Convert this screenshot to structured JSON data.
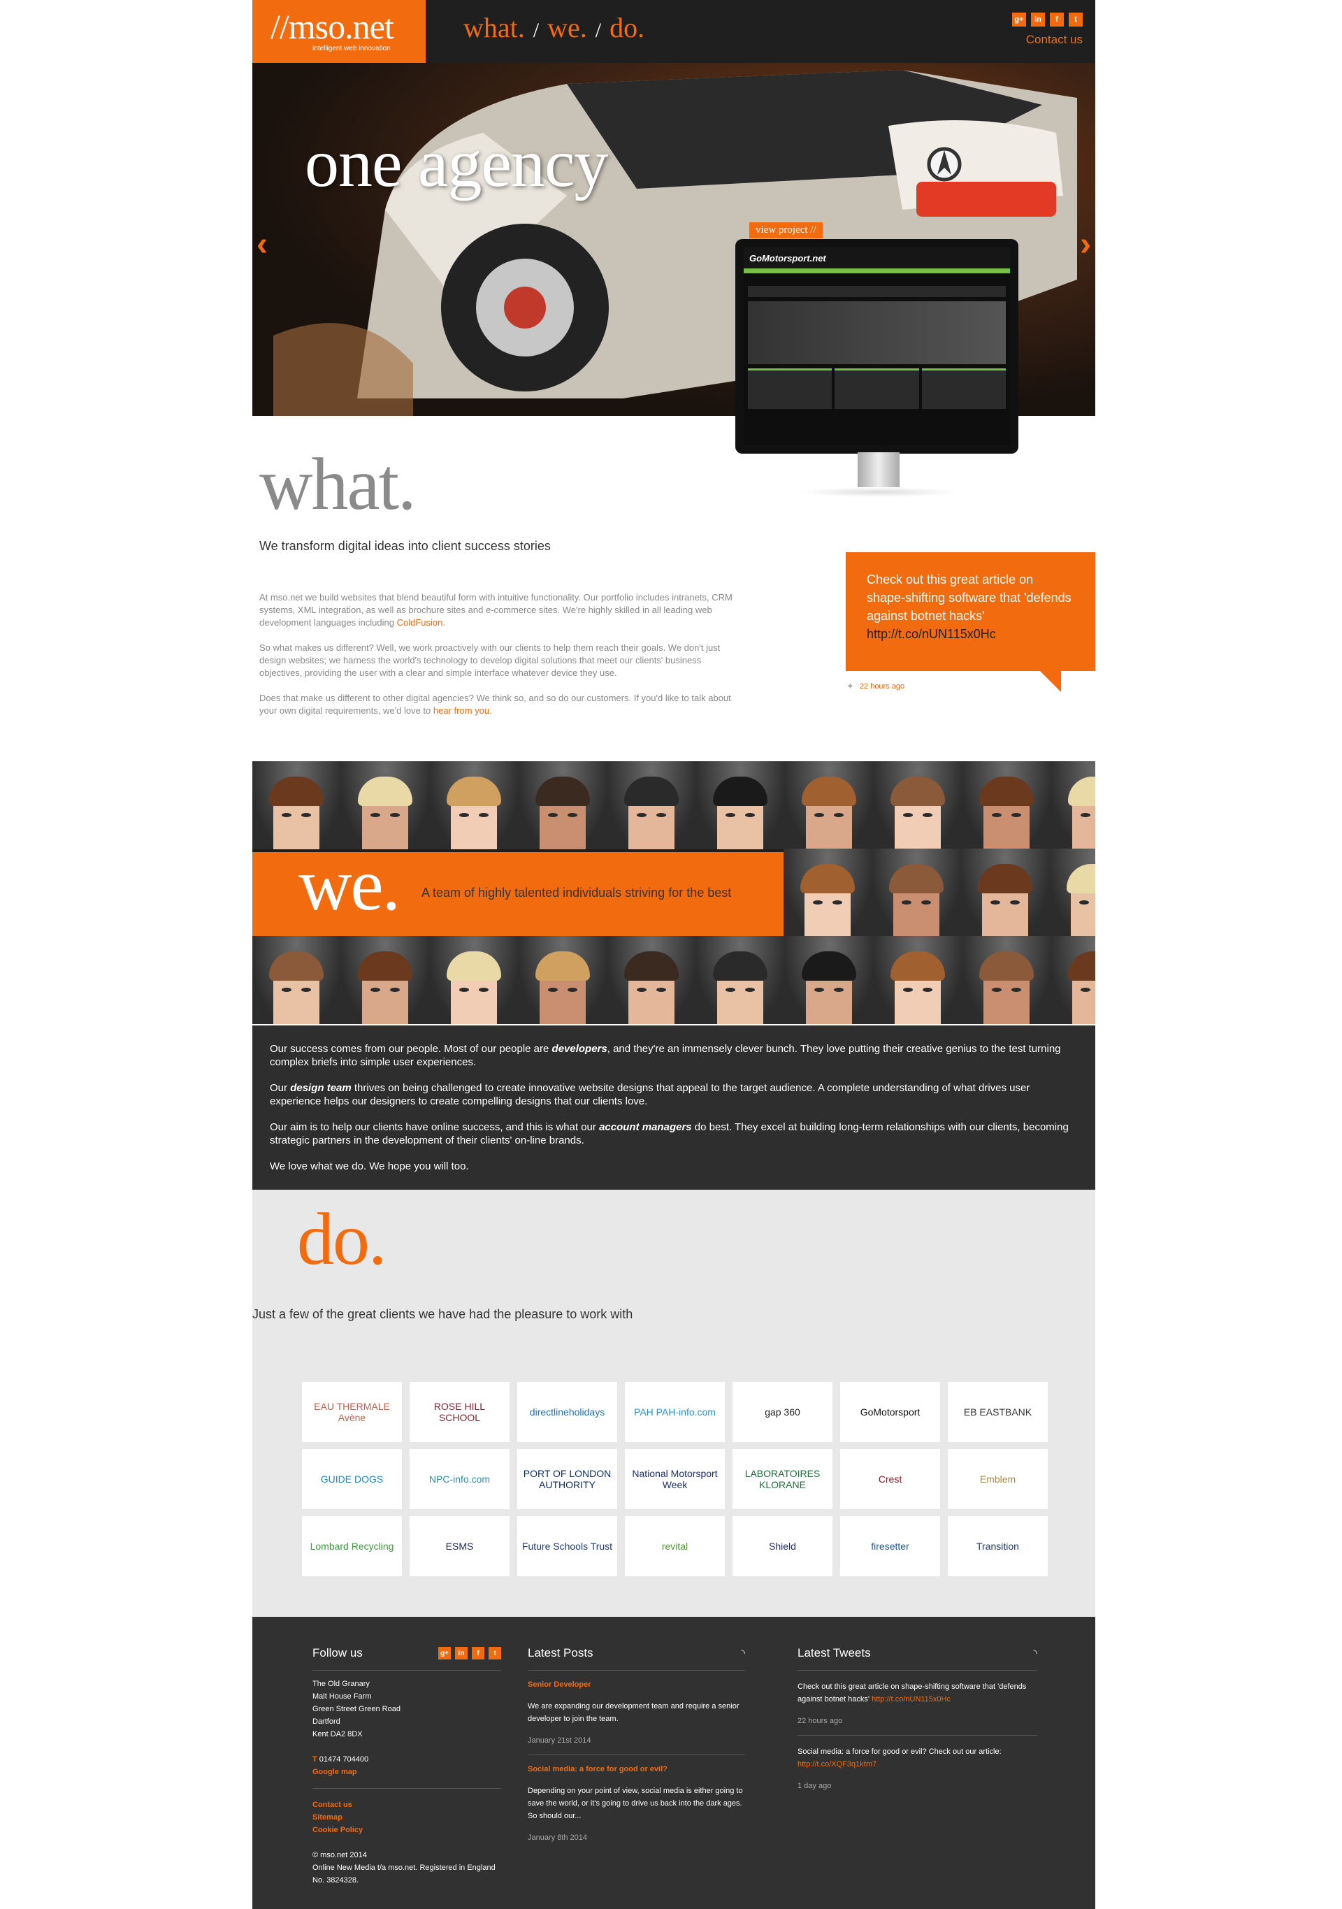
{
  "header": {
    "logo_mark": "//mso.net",
    "logo_tagline": "intelligent web innovation",
    "nav": [
      "what.",
      "we.",
      "do."
    ],
    "nav_sep": "/",
    "social_icons": [
      "g+",
      "in",
      "f",
      "t"
    ],
    "contact": "Contact us"
  },
  "hero": {
    "title": "one agency",
    "view_project": "view project //",
    "site_name": "GoMotorsport.net",
    "prev": "‹",
    "next": "›"
  },
  "what": {
    "heading": "what",
    "dot": ".",
    "subtitle": "We transform digital ideas into client success stories",
    "p1": "At mso.net we build websites that blend beautiful form with intuitive functionality. Our portfolio includes intranets, CRM systems, XML integration, as well as brochure sites and e-commerce sites. We're highly skilled in all leading web development languages including ",
    "p1_link": "ColdFusion",
    "p1_end": ".",
    "p2": "So what makes us different? Well, we work proactively with our clients to help them reach their goals. We don't just design websites; we harness the world's technology to develop digital solutions that meet our clients' business objectives, providing the user with a clear and simple interface whatever device they use.",
    "p3": "Does that make us different to other digital agencies? We think so, and so do our customers. If you'd like to talk about your own digital requirements, we'd love to ",
    "p3_link": "hear from you",
    "p3_end": ".",
    "tweet": "Check out this great article on shape-shifting software that 'defends against botnet hacks'",
    "tweet_link": "http://t.co/nUN115x0Hc",
    "tweet_time": "22 hours ago"
  },
  "we": {
    "heading": "we",
    "dot": ".",
    "tagline": "A team of highly talented individuals striving for the best",
    "p1a": "Our success comes from our people. Most of our people are ",
    "p1b": "developers",
    "p1c": ", and they're an immensely clever bunch. They love putting their creative genius to the test turning complex briefs into simple user experiences.",
    "p2a": "Our ",
    "p2b": "design team",
    "p2c": " thrives on being challenged to create innovative website designs that appeal to the target audience. A complete understanding of what drives user experience helps our designers to create compelling designs that our clients love.",
    "p3a": "Our aim is to help our clients have online success, and this is what our ",
    "p3b": "account managers",
    "p3c": " do best. They excel at building long-term relationships with our clients, becoming strategic partners in the development of their clients' on-line brands.",
    "p4": "We love what we do. We hope you will too."
  },
  "do": {
    "heading": "do",
    "dot": ".",
    "subtitle": "Just a few of the great clients we have had the pleasure to work with",
    "clients": [
      {
        "name": "EAU THERMALE Avène",
        "color": "#c0614f"
      },
      {
        "name": "ROSE HILL SCHOOL",
        "color": "#7b2431"
      },
      {
        "name": "directlineholidays",
        "color": "#1f6fb3"
      },
      {
        "name": "PAH PAH-info.com",
        "color": "#2b8fd1"
      },
      {
        "name": "gap 360",
        "color": "#222222"
      },
      {
        "name": "GoMotorsport",
        "color": "#111111"
      },
      {
        "name": "EB EASTBANK",
        "color": "#333333"
      },
      {
        "name": "GUIDE DOGS",
        "color": "#1b86c9"
      },
      {
        "name": "NPC-info.com",
        "color": "#2e8fa8"
      },
      {
        "name": "PORT OF LONDON AUTHORITY",
        "color": "#0d2a5e"
      },
      {
        "name": "National Motorsport Week",
        "color": "#1c2f6e"
      },
      {
        "name": "LABORATOIRES KLORANE",
        "color": "#1f6b3a"
      },
      {
        "name": "Crest",
        "color": "#8a1c22"
      },
      {
        "name": "Emblem",
        "color": "#a68b4a"
      },
      {
        "name": "Lombard Recycling",
        "color": "#3c9a3c"
      },
      {
        "name": "ESMS",
        "color": "#1e2a5a"
      },
      {
        "name": "Future Schools Trust",
        "color": "#1f3a7a"
      },
      {
        "name": "revital",
        "color": "#4a9a2a"
      },
      {
        "name": "Shield",
        "color": "#1c2c6a"
      },
      {
        "name": "firesetter",
        "color": "#1d5a9a"
      },
      {
        "name": "Transition",
        "color": "#1b3a6b"
      }
    ]
  },
  "footer": {
    "follow": "Follow us",
    "address": [
      "The Old Granary",
      "Malt House Farm",
      "Green Street Green Road",
      "Dartford",
      "Kent DA2 8DX"
    ],
    "phone_label": "T",
    "phone": "01474 704400",
    "map": "Google map",
    "links": [
      "Contact us",
      "Sitemap",
      "Cookie Policy"
    ],
    "copyright": "© mso.net 2014",
    "company": "Online New Media t/a mso.net. Registered in England No. 3824328.",
    "posts_heading": "Latest Posts",
    "posts": [
      {
        "title": "Senior Developer",
        "body": "We are expanding our development team and require a senior developer to join the team.",
        "date": "January 21st 2014"
      },
      {
        "title": "Social media: a force for good or evil?",
        "body": "Depending on your point of view, social media is either going to save the world, or it's going to drive us back into the dark ages. So should our...",
        "date": "January 8th 2014"
      }
    ],
    "tweets_heading": "Latest Tweets",
    "tweets": [
      {
        "text": "Check out this great article on shape-shifting software that 'defends against botnet hacks'",
        "link": "http://t.co/nUN115x0Hc",
        "time": "22 hours ago"
      },
      {
        "text": "Social media: a force for good or evil? Check out our article:",
        "link": "http://t.co/XQF3q1ktm7",
        "time": "1 day ago"
      }
    ]
  }
}
